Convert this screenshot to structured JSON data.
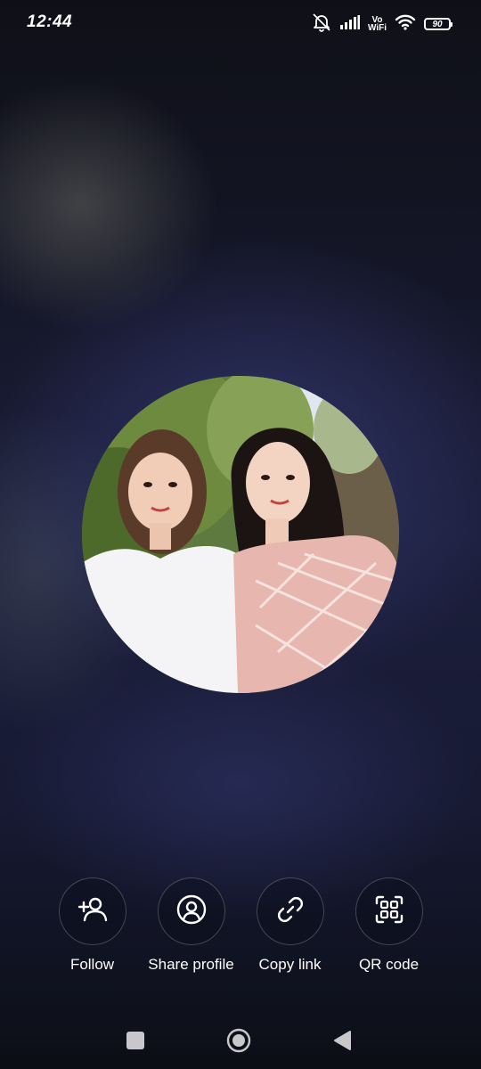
{
  "status_bar": {
    "time": "12:44",
    "vo_label": "Vo",
    "wifi_label": "WiFi",
    "battery": "90",
    "icons": [
      "mute-icon",
      "signal-icon",
      "vowifi-icon",
      "wifi-icon",
      "battery-icon"
    ]
  },
  "profile_photo": {
    "icon": "profile-photo"
  },
  "actions": [
    {
      "label": "Follow",
      "icon": "add-person-icon"
    },
    {
      "label": "Share profile",
      "icon": "profile-circle-icon"
    },
    {
      "label": "Copy link",
      "icon": "link-icon"
    },
    {
      "label": "QR code",
      "icon": "qr-code-icon"
    }
  ],
  "nav_bar": {
    "icons": [
      "recents-icon",
      "home-icon",
      "back-icon"
    ]
  },
  "colors": {
    "background": "#1c1f3c",
    "text": "#ffffff",
    "button_border": "#3a3c4c"
  }
}
